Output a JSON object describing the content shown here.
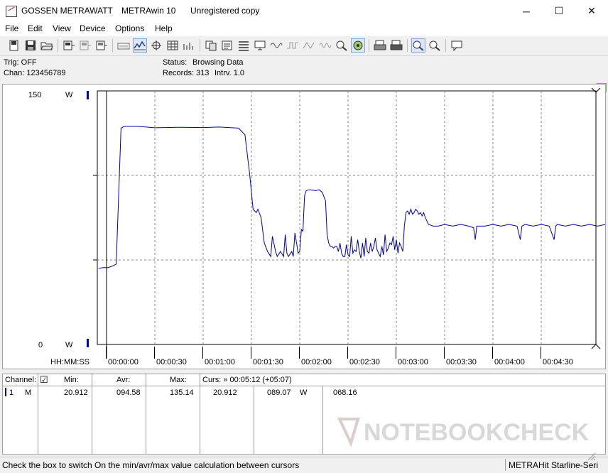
{
  "titlebar": {
    "app_name": "GOSSEN METRAWATT",
    "product": "METRAwin 10",
    "license": "Unregistered copy",
    "minimize": "─",
    "maximize": "☐",
    "close": "✕"
  },
  "menu": [
    "File",
    "Edit",
    "View",
    "Device",
    "Options",
    "Help"
  ],
  "status": {
    "trig": "Trig: OFF",
    "chan": "Chan:  123456789",
    "status_label": "Status:",
    "status_value": "Browsing Data",
    "records_label": "Records: 313",
    "interval_label": "Intrv. 1.0"
  },
  "chart_data": {
    "type": "line",
    "unit": "W",
    "y_max_label": "150",
    "y_min_label": "0",
    "ylim": [
      0,
      150
    ],
    "x_axis_label": "HH:MM:SS",
    "x_ticks": [
      "00:00:00",
      "00:00:30",
      "00:01:00",
      "00:01:30",
      "00:02:00",
      "00:02:30",
      "00:03:00",
      "00:03:30",
      "00:04:00",
      "00:04:30"
    ],
    "grid": true,
    "series_color": "#0000aa",
    "series": [
      {
        "values": [
          [
            -5,
            45
          ],
          [
            -2,
            45.5
          ],
          [
            1,
            45.5
          ],
          [
            4,
            46.5
          ],
          [
            6,
            47.5
          ],
          [
            9,
            128
          ],
          [
            11,
            129
          ],
          [
            20,
            129
          ],
          [
            30,
            128.2
          ],
          [
            45,
            128.5
          ],
          [
            60,
            128.3
          ],
          [
            70,
            128.6
          ],
          [
            82,
            128
          ],
          [
            86,
            124
          ],
          [
            89,
            100
          ],
          [
            91,
            80
          ],
          [
            93,
            78
          ],
          [
            94,
            80
          ],
          [
            96,
            75
          ],
          [
            98,
            60
          ],
          [
            100,
            55
          ],
          [
            102,
            52
          ],
          [
            103,
            64
          ],
          [
            105,
            55
          ],
          [
            106,
            52
          ],
          [
            108,
            55
          ],
          [
            110,
            52
          ],
          [
            111,
            65
          ],
          [
            112,
            54
          ],
          [
            113,
            52
          ],
          [
            115,
            55
          ],
          [
            116,
            52
          ],
          [
            117,
            66
          ],
          [
            118,
            60
          ],
          [
            119,
            54
          ],
          [
            120,
            55
          ],
          [
            121,
            68
          ],
          [
            122,
            67
          ],
          [
            123,
            88
          ],
          [
            124,
            91
          ],
          [
            126,
            91.5
          ],
          [
            130,
            91
          ],
          [
            132,
            91.5
          ],
          [
            134,
            90
          ],
          [
            136,
            85
          ],
          [
            137,
            65
          ],
          [
            138,
            60
          ],
          [
            139,
            58
          ],
          [
            140,
            58
          ],
          [
            141,
            57
          ],
          [
            142,
            58
          ],
          [
            143,
            58
          ],
          [
            144,
            55
          ],
          [
            145,
            60
          ],
          [
            146,
            54
          ],
          [
            147,
            52
          ],
          [
            148,
            52
          ],
          [
            149,
            59
          ],
          [
            150,
            53
          ],
          [
            151,
            52
          ],
          [
            152,
            64
          ],
          [
            153,
            54
          ],
          [
            154,
            56
          ],
          [
            155,
            55
          ],
          [
            156,
            62
          ],
          [
            157,
            55
          ],
          [
            158,
            51
          ],
          [
            159,
            60
          ],
          [
            160,
            52
          ],
          [
            161,
            63
          ],
          [
            162,
            55
          ],
          [
            163,
            54
          ],
          [
            164,
            60
          ],
          [
            165,
            55
          ],
          [
            166,
            58
          ],
          [
            167,
            63
          ],
          [
            168,
            56
          ],
          [
            169,
            54
          ],
          [
            170,
            52
          ],
          [
            171,
            58
          ],
          [
            172,
            53
          ],
          [
            173,
            65
          ],
          [
            174,
            55
          ],
          [
            175,
            57
          ],
          [
            176,
            60
          ],
          [
            177,
            59
          ],
          [
            178,
            64
          ],
          [
            179,
            56
          ],
          [
            180,
            62
          ],
          [
            181,
            54
          ],
          [
            182,
            60
          ],
          [
            183,
            58
          ],
          [
            184,
            55
          ],
          [
            185,
            70
          ],
          [
            186,
            78
          ],
          [
            187,
            79
          ],
          [
            188,
            77
          ],
          [
            189,
            80
          ],
          [
            190,
            77
          ],
          [
            191,
            78
          ],
          [
            192,
            80
          ],
          [
            193,
            79
          ],
          [
            194,
            77
          ],
          [
            195,
            78
          ],
          [
            196,
            76
          ],
          [
            197,
            78
          ],
          [
            198,
            75
          ],
          [
            199,
            73
          ],
          [
            200,
            71
          ],
          [
            203,
            70
          ],
          [
            206,
            70
          ],
          [
            210,
            71
          ],
          [
            215,
            70
          ],
          [
            220,
            71
          ],
          [
            225,
            70
          ],
          [
            228,
            69
          ],
          [
            229,
            62
          ],
          [
            230,
            70
          ],
          [
            235,
            70
          ],
          [
            240,
            71
          ],
          [
            245,
            70
          ],
          [
            250,
            71
          ],
          [
            255,
            70
          ],
          [
            257,
            62
          ],
          [
            258,
            70
          ],
          [
            260,
            71
          ],
          [
            265,
            70
          ],
          [
            270,
            71
          ],
          [
            275,
            70
          ],
          [
            278,
            62
          ],
          [
            279,
            70
          ],
          [
            280,
            71
          ],
          [
            285,
            70
          ],
          [
            290,
            71
          ],
          [
            295,
            70
          ],
          [
            300,
            71
          ],
          [
            305,
            70
          ],
          [
            310,
            71
          ],
          [
            315,
            70
          ],
          [
            316,
            58
          ],
          [
            317,
            70
          ],
          [
            320,
            71
          ],
          [
            325,
            70
          ],
          [
            330,
            71
          ],
          [
            335,
            70
          ],
          [
            340,
            71
          ],
          [
            345,
            70
          ],
          [
            350,
            71
          ],
          [
            355,
            70
          ],
          [
            360,
            71
          ],
          [
            365,
            70
          ],
          [
            370,
            71
          ],
          [
            372,
            70
          ]
        ]
      }
    ]
  },
  "table": {
    "headers": {
      "channel": "Channel:",
      "checkbox": "☑",
      "min": "Min:",
      "avr": "Avr:",
      "max": "Max:",
      "curs": "Curs: » 00:05:12 (+05:07)"
    },
    "row": {
      "channel": "1",
      "mode": "M",
      "min": "20.912",
      "avr": "094.58",
      "max": "135.14",
      "cursor_value": "20.912",
      "cursor_avr": "089.07",
      "unit": "W",
      "extra": "068.16"
    }
  },
  "statusbar": {
    "hint": "Check the box to switch On the min/avr/max value calculation between cursors",
    "device": "METRAHit Starline-Seri"
  },
  "watermark": {
    "brand": "NOTEBOOKCHECK"
  }
}
